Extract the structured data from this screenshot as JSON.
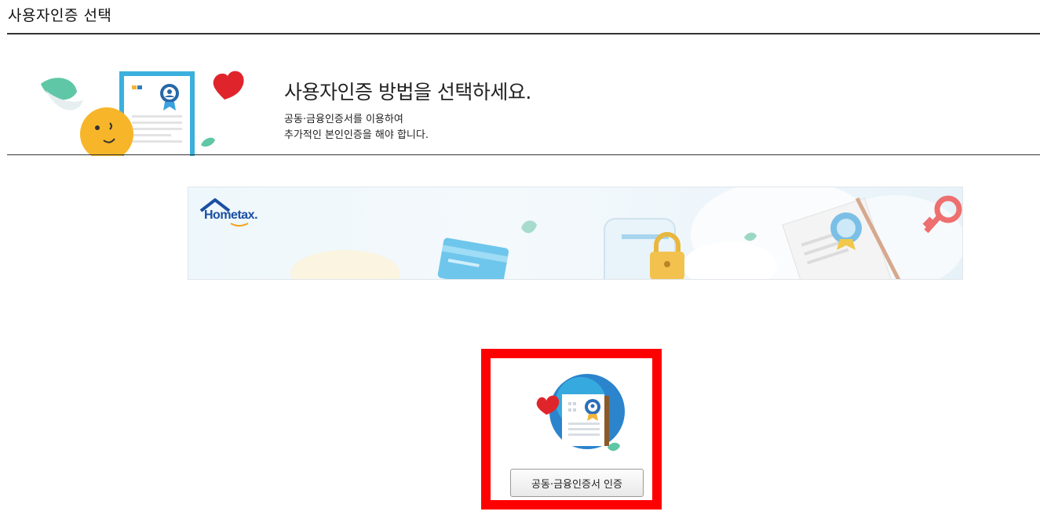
{
  "page": {
    "title": "사용자인증 선택"
  },
  "intro": {
    "heading": "사용자인증 방법을 선택하세요.",
    "line1": "공동·금융인증서를 이용하여",
    "line2": "추가적인 본인인증을 해야 합니다."
  },
  "banner": {
    "logo_text": "Hometax."
  },
  "auth_option": {
    "button_label": "공동·금융인증서 인증",
    "highlight_color": "#ff0000"
  },
  "icons": {
    "intro": "certificate-illustration",
    "banner": "hometax-banner-illustration",
    "option": "certificate-icon"
  }
}
